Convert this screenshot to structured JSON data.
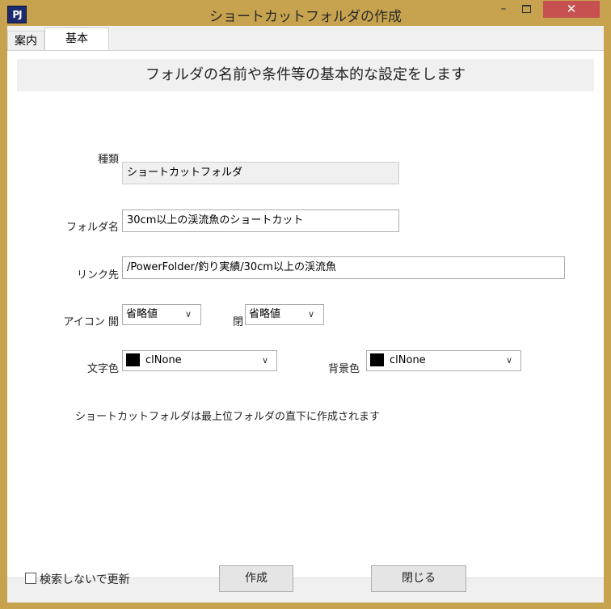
{
  "window": {
    "title": "ショートカットフォルダの作成",
    "app_icon_text": "PJ",
    "close_glyph": "✕",
    "minimize_glyph": "–"
  },
  "tabs": [
    {
      "label": "案内"
    },
    {
      "label": "基本"
    }
  ],
  "banner": "フォルダの名前や条件等の基本的な設定をします",
  "form": {
    "kind_label": "種類",
    "kind_value": "ショートカットフォルダ",
    "name_label": "フォルダ名",
    "name_value": "30cm以上の渓流魚のショートカット",
    "link_label": "リンク先",
    "link_value": "/PowerFolder/釣り実績/30cm以上の渓流魚",
    "icon_label": "アイコン 開",
    "icon_open_value": "省略値",
    "icon_closed_label": "閉",
    "icon_closed_value": "省略値",
    "text_color_label": "文字色",
    "text_color_value": "clNone",
    "bg_color_label": "背景色",
    "bg_color_value": "clNone",
    "note": "ショートカットフォルダは最上位フォルダの直下に作成されます"
  },
  "footer": {
    "no_search_label": "検索しないで更新",
    "no_search_checked": false,
    "create_button": "作成",
    "close_button": "閉じる"
  },
  "colors": {
    "titlebar": "#c7a34f",
    "close": "#c75050",
    "swatch_text": "#000000",
    "swatch_bg": "#000000"
  },
  "icons": {
    "dropdown": "chevron-down-icon"
  }
}
